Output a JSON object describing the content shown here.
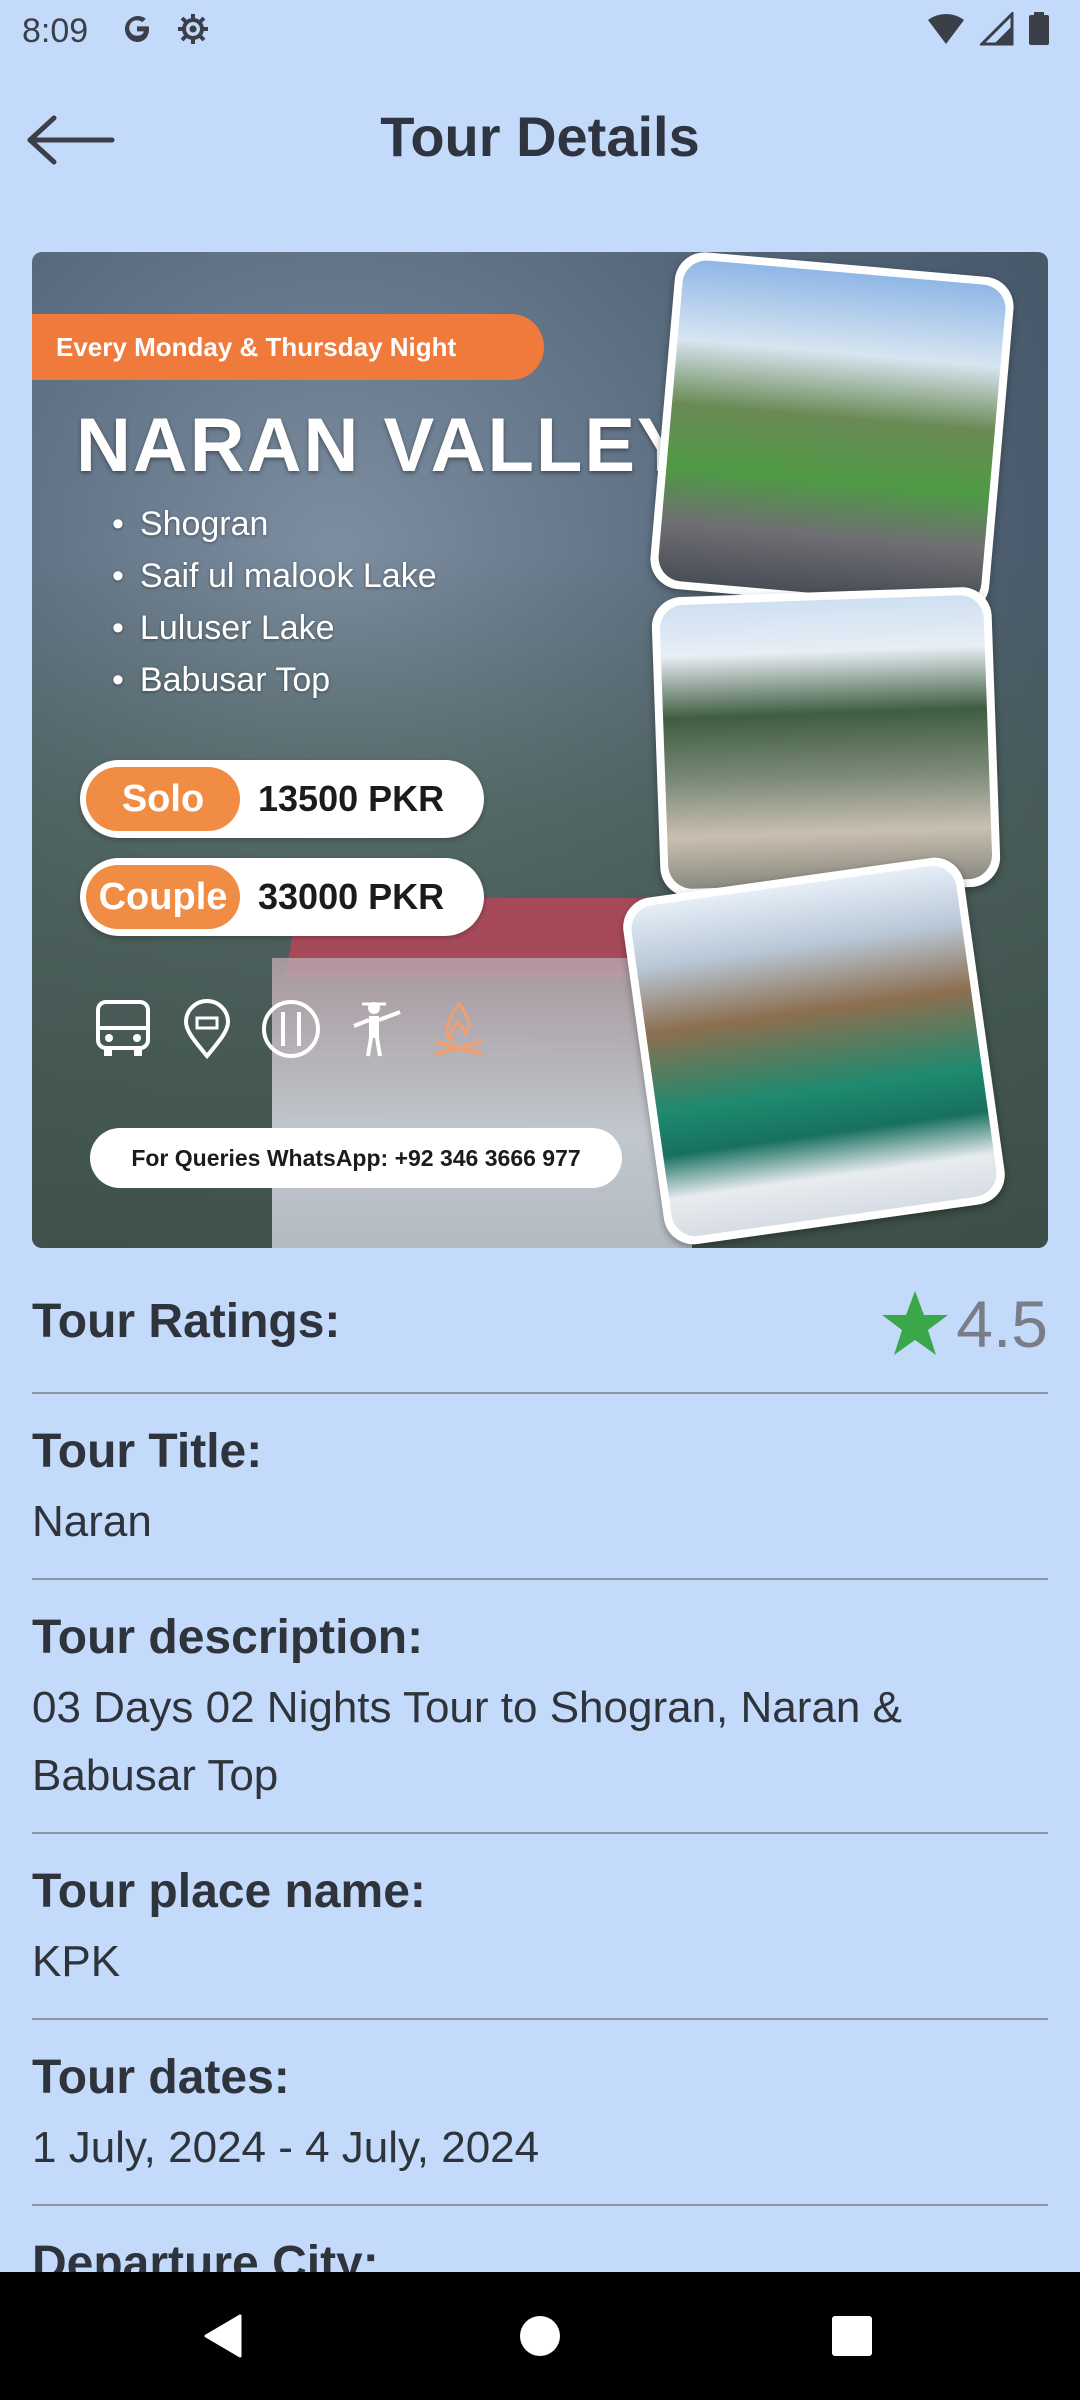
{
  "status_bar": {
    "time": "8:09",
    "left_icons": [
      "google-icon",
      "settings-gear-icon"
    ],
    "right_icons": [
      "wifi-icon",
      "cellular-signal-icon",
      "battery-icon"
    ]
  },
  "app_bar": {
    "title": "Tour Details",
    "back_icon": "arrow-left-icon"
  },
  "poster": {
    "banner": "Every Monday & Thursday Night",
    "title": "NARAN VALLEY",
    "stops": [
      "Shogran",
      "Saif ul malook Lake",
      "Luluser Lake",
      "Babusar Top"
    ],
    "prices": [
      {
        "tag": "Solo",
        "value": "13500 PKR"
      },
      {
        "tag": "Couple",
        "value": "33000 PKR"
      }
    ],
    "amenities": [
      "bus-icon",
      "hotel-location-icon",
      "meal-icon",
      "guide-icon",
      "campfire-icon"
    ],
    "contact": "For Queries WhatsApp: +92 346 3666 977"
  },
  "details": {
    "ratings": {
      "label": "Tour Ratings:",
      "value": "4.5",
      "star_color": "#3aa84a"
    },
    "fields": [
      {
        "label": "Tour Title:",
        "value": "Naran"
      },
      {
        "label": "Tour description:",
        "value": "03 Days 02 Nights Tour to Shogran, Naran & Babusar Top"
      },
      {
        "label": "Tour place name:",
        "value": "KPK"
      },
      {
        "label": "Tour dates:",
        "value": "1 July, 2024 - 4 July, 2024"
      }
    ],
    "partial_label": "Departure City:"
  },
  "nav_bar": {
    "buttons": [
      "back-triangle-icon",
      "home-circle-icon",
      "recents-square-icon"
    ]
  },
  "colors": {
    "background": "#c4dafa",
    "accent_orange": "#f07a3c",
    "star_green": "#3aa84a"
  }
}
